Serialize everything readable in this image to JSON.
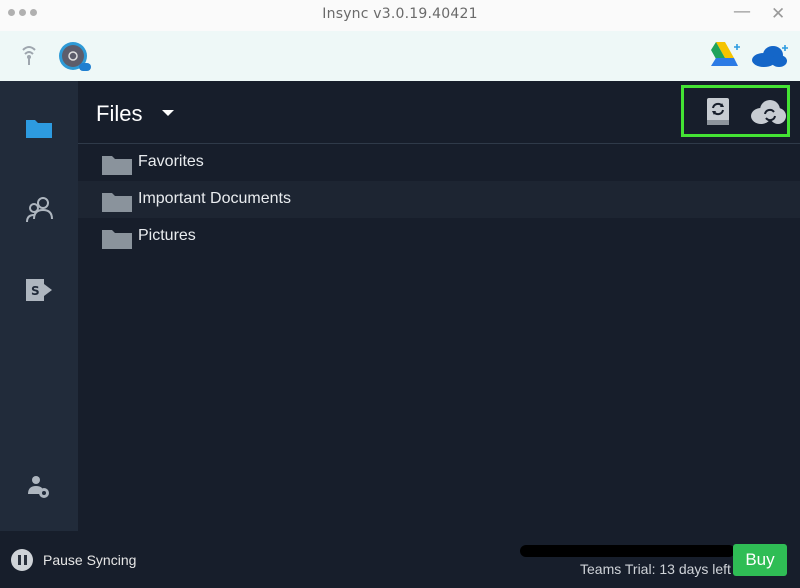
{
  "window": {
    "title": "Insync v3.0.19.40421"
  },
  "colors": {
    "accent_blue": "#2d9be0",
    "highlight": "#44e334",
    "buy_green": "#2fbd55",
    "sidebar_bg": "#212b3a",
    "main_bg": "#171e2b"
  },
  "accountbar": {
    "icons": [
      "wifi-icon",
      "avatar",
      "google-drive-add-icon",
      "onedrive-add-icon"
    ]
  },
  "sidebar": {
    "items": [
      {
        "name": "files",
        "icon": "folder-icon",
        "active": true
      },
      {
        "name": "shared",
        "icon": "people-icon",
        "active": false
      },
      {
        "name": "sharepoint",
        "icon": "sharepoint-icon",
        "active": false
      },
      {
        "name": "account-settings",
        "icon": "user-settings-icon",
        "active": false
      }
    ]
  },
  "main": {
    "title": "Files",
    "header_icons": [
      "local-sync-icon",
      "cloud-sync-icon"
    ],
    "files": [
      {
        "name": "Favorites"
      },
      {
        "name": "Important Documents"
      },
      {
        "name": "Pictures"
      }
    ]
  },
  "footer": {
    "pause_label": "Pause Syncing",
    "trial_text": "Teams Trial: 13 days left",
    "buy_label": "Buy"
  }
}
